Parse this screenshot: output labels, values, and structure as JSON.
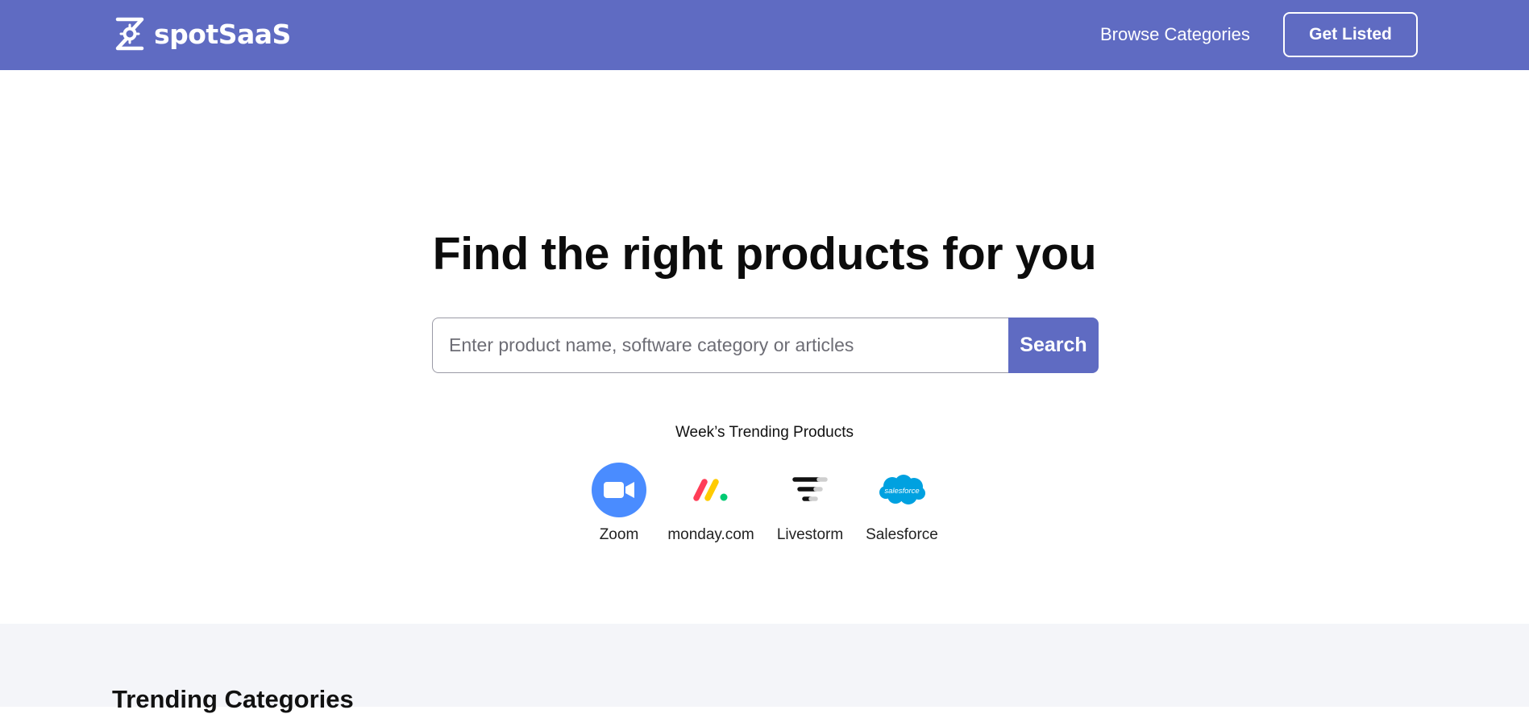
{
  "header": {
    "logo_text": "spotSaaS",
    "nav_link": "Browse Categories",
    "cta_label": "Get Listed",
    "colors": {
      "brand": "#5f6bc2",
      "text_on_brand": "#ffffff"
    }
  },
  "hero": {
    "title": "Find the right products for you",
    "search": {
      "placeholder": "Enter product name, software category or articles",
      "value": "",
      "button_label": "Search"
    },
    "trending_label": "Week’s Trending Products",
    "trending_products": [
      {
        "name": "Zoom",
        "icon": "zoom-icon"
      },
      {
        "name": "monday.com",
        "icon": "monday-icon"
      },
      {
        "name": "Livestorm",
        "icon": "livestorm-icon"
      },
      {
        "name": "Salesforce",
        "icon": "salesforce-icon",
        "logo_text": "salesforce"
      }
    ]
  },
  "categories": {
    "heading": "Trending Categories"
  }
}
